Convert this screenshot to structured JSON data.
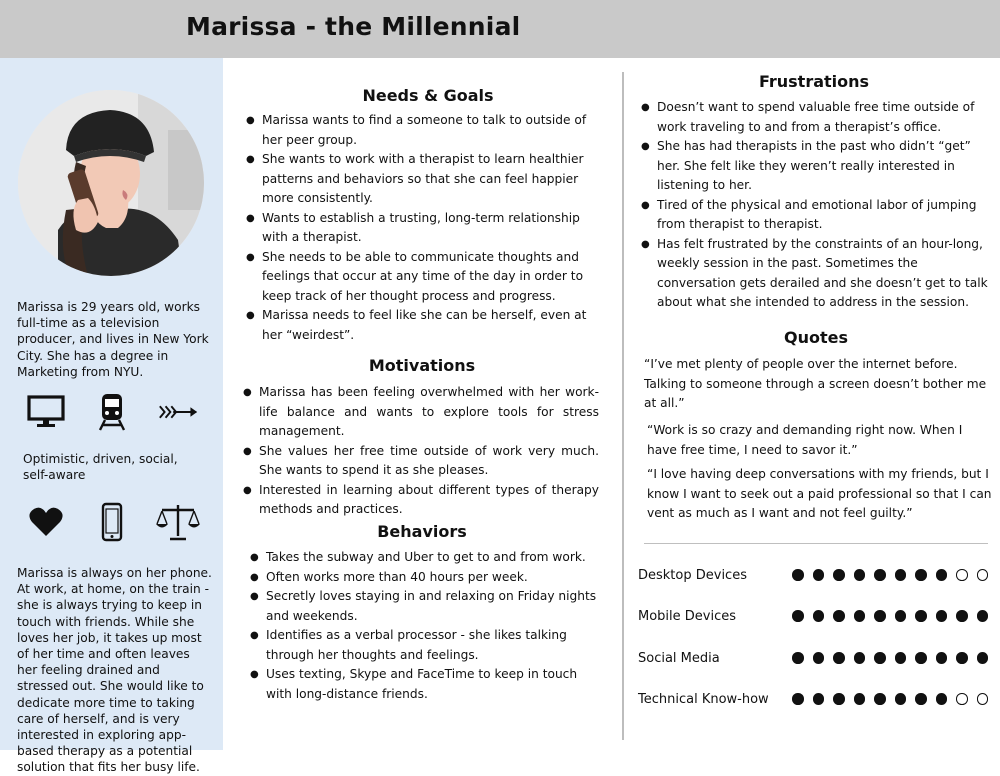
{
  "title": "Marissa - the Millennial",
  "colors": {
    "header": "#c9c9c9",
    "sidebar": "#dde9f6",
    "text": "#111111"
  },
  "sidebar": {
    "bio": "Marissa is 29 years old, works full-time as a television producer, and lives in New York City. She has a degree in Marketing from NYU.",
    "icons_row1": [
      "monitor-icon",
      "train-icon",
      "arrow-icon"
    ],
    "traits": "Optimistic, driven, social, self-aware",
    "icons_row2": [
      "heart-icon",
      "smartphone-icon",
      "scales-icon"
    ],
    "story": "Marissa is always on her phone. At work, at home, on the train - she is always trying to keep in touch with friends. While she loves her job, it takes up most of her time and often leaves her feeling drained and stressed out. She would like to dedicate more time to taking care of herself, and is very interested in exploring app-based therapy as a potential solution that fits her busy life."
  },
  "needs_goals": {
    "heading": "Needs & Goals",
    "items": [
      "Marissa wants to find a someone to talk to outside of her peer group.",
      "She wants to work with a therapist to learn healthier patterns and behaviors so that she can feel happier more consistently.",
      "Wants to establish a trusting, long-term relationship with a therapist.",
      "She needs to be able to communicate thoughts and feelings that occur at any time of the day in order to keep track of her thought process and progress.",
      "Marissa needs to feel like she can be herself, even at her “weirdest”."
    ]
  },
  "motivations": {
    "heading": "Motivations",
    "items": [
      "Marissa has been feeling overwhelmed with her work-life balance and wants to explore tools for stress management.",
      "She values her free time outside of work very much. She wants to spend it as she pleases.",
      "Interested in learning about different types of therapy methods and practices."
    ]
  },
  "behaviors": {
    "heading": "Behaviors",
    "items": [
      "Takes the subway and Uber to get to and from work.",
      "Often works more than 40 hours per week.",
      "Secretly loves staying in and relaxing on Friday nights and weekends.",
      "Identifies as a verbal processor - she likes talking through her thoughts and feelings.",
      "Uses texting, Skype and FaceTime to keep in touch with long-distance friends."
    ]
  },
  "frustrations": {
    "heading": "Frustrations",
    "items": [
      "Doesn’t want to spend valuable free time outside of work traveling to and from a therapist’s office.",
      "She has had therapists in the past who didn’t “get” her. She felt like they weren’t really interested in listening to her.",
      "Tired of the physical and emotional labor of jumping from therapist to therapist.",
      "Has felt frustrated by the constraints of an hour-long, weekly session in the past. Sometimes the conversation gets derailed and she doesn’t get to talk about what she intended to address in the session."
    ]
  },
  "quotes": {
    "heading": "Quotes",
    "items": [
      "“I’ve met plenty of people over the internet before. Talking to someone through a screen doesn’t bother me at all.”",
      "“Work is so crazy and demanding right now. When I have free time, I need to savor it.”",
      "“I love having deep conversations with my friends, but I know I want to seek out a paid professional so that I can vent as much as I want and not feel guilty.”"
    ]
  },
  "ratings": [
    {
      "label": "Desktop Devices",
      "filled": 8,
      "max": 10
    },
    {
      "label": "Mobile Devices",
      "filled": 10,
      "max": 10
    },
    {
      "label": "Social Media",
      "filled": 10,
      "max": 10
    },
    {
      "label": "Technical Know-how",
      "filled": 8,
      "max": 10
    }
  ]
}
